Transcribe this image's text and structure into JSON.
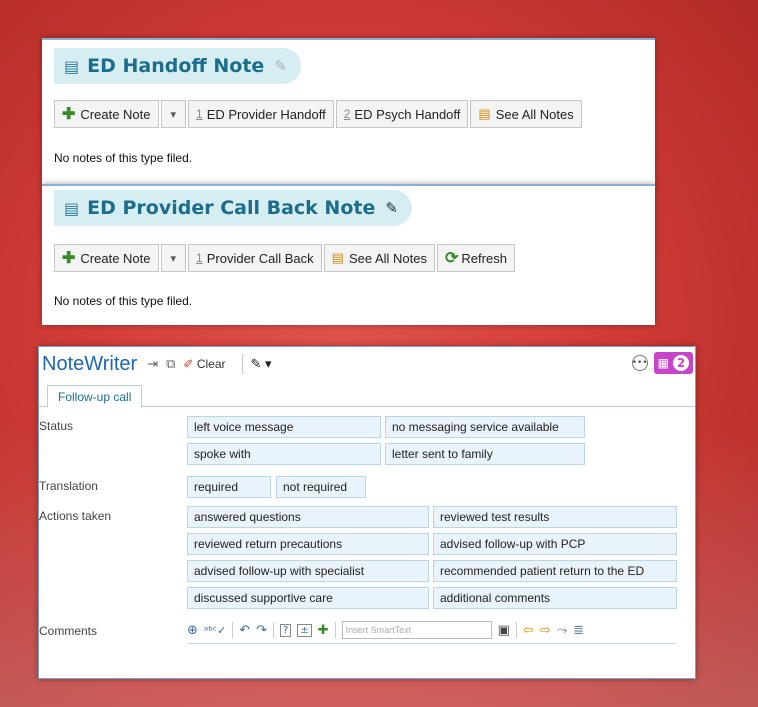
{
  "handoff": {
    "title": "ED Handoff Note",
    "buttons": {
      "create": "Create Note",
      "provider_num": "1",
      "provider": "ED Provider Handoff",
      "psych_num": "2",
      "psych": "ED Psych Handoff",
      "see_all": "See All Notes"
    },
    "empty": "No notes of this type filed."
  },
  "callback": {
    "title": "ED Provider Call Back Note",
    "buttons": {
      "create": "Create Note",
      "provider_num": "1",
      "provider": "Provider Call Back",
      "see_all": "See All Notes",
      "refresh": "Refresh"
    },
    "empty": "No notes of this type filed."
  },
  "notewriter": {
    "title": "NoteWriter",
    "clear": "Clear",
    "badge_count": "2",
    "tab": "Follow-up call",
    "status_label": "Status",
    "status_opts": [
      "left voice message",
      "no messaging service available",
      "spoke with",
      "letter sent to family"
    ],
    "translation_label": "Translation",
    "translation_opts": [
      "required",
      "not required"
    ],
    "actions_label": "Actions taken",
    "actions_opts": [
      "answered questions",
      "reviewed test results",
      "reviewed return precautions",
      "advised follow-up with PCP",
      "advised follow-up with specialist",
      "recommended patient return to the ED",
      "discussed supportive care",
      "additional comments"
    ],
    "comments_label": "Comments",
    "smarttext_placeholder": "Insert SmartText"
  },
  "colors": {
    "accent_blue": "#1c66b4",
    "section_teal": "#1b6d8b",
    "badge_magenta": "#c546c9",
    "background_red": "#d23c37"
  }
}
